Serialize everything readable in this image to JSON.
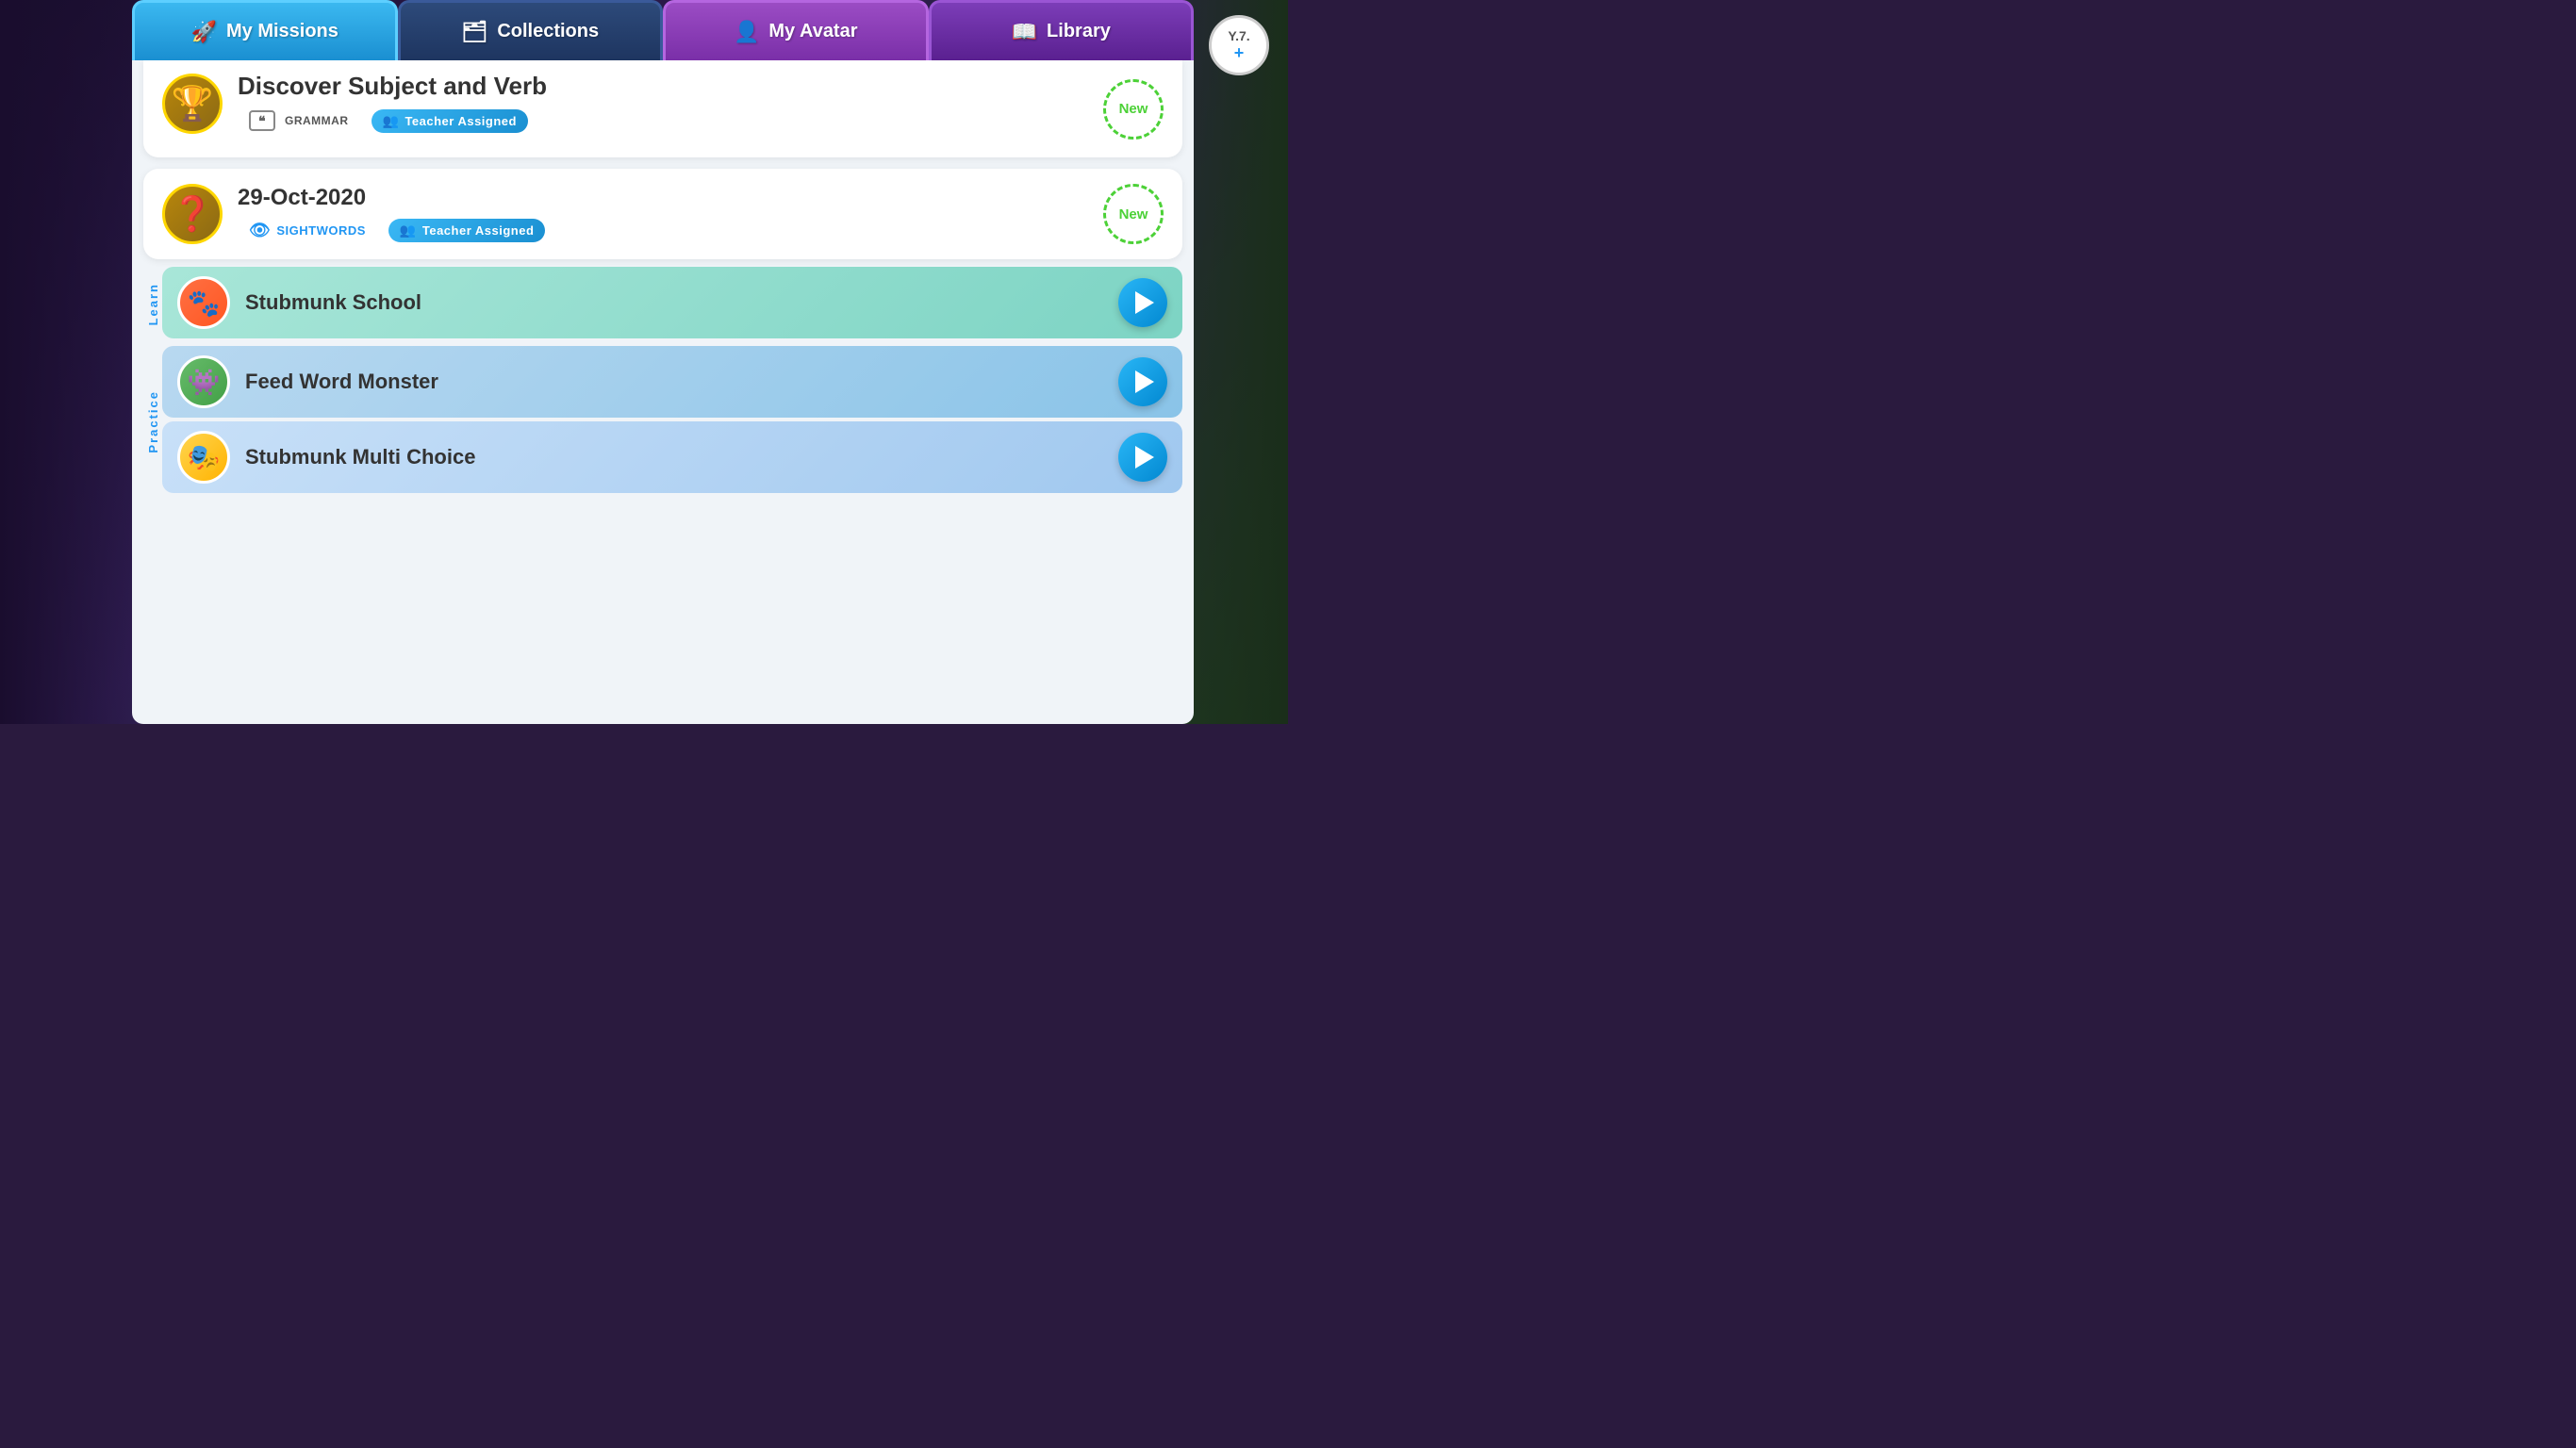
{
  "app": {
    "user": {
      "label": "Y.7.",
      "plus": "+"
    }
  },
  "nav": {
    "tabs": [
      {
        "id": "my-missions",
        "label": "My Missions",
        "icon": "🚀",
        "active": true,
        "colorClass": "active"
      },
      {
        "id": "collections",
        "label": "Collections",
        "icon": "🗂",
        "active": false,
        "colorClass": "collections"
      },
      {
        "id": "my-avatar",
        "label": "My Avatar",
        "icon": "👤",
        "active": false,
        "colorClass": "my-avatar"
      },
      {
        "id": "library",
        "label": "Library",
        "icon": "📖",
        "active": false,
        "colorClass": "library"
      }
    ]
  },
  "missions": {
    "partial_card": {
      "title": "Discover Subject and Verb",
      "category": "GRAMMAR",
      "teacher_assigned": "Teacher Assigned",
      "new_label": "New"
    },
    "main_card": {
      "date": "29-Oct-2020",
      "category": "SIGHTWORDS",
      "teacher_assigned": "Teacher Assigned",
      "new_label": "New",
      "icon": "❓"
    },
    "activities": {
      "learn_label": "Learn",
      "practice_label": "Practice",
      "items": [
        {
          "id": "stubmunk-school",
          "name": "Stubmunk School",
          "type": "learn",
          "icon": "🐾"
        },
        {
          "id": "feed-word-monster",
          "name": "Feed Word Monster",
          "type": "practice",
          "icon": "👾"
        },
        {
          "id": "stubmunk-multi-choice",
          "name": "Stubmunk Multi Choice",
          "type": "practice",
          "icon": "🎭"
        }
      ]
    }
  }
}
